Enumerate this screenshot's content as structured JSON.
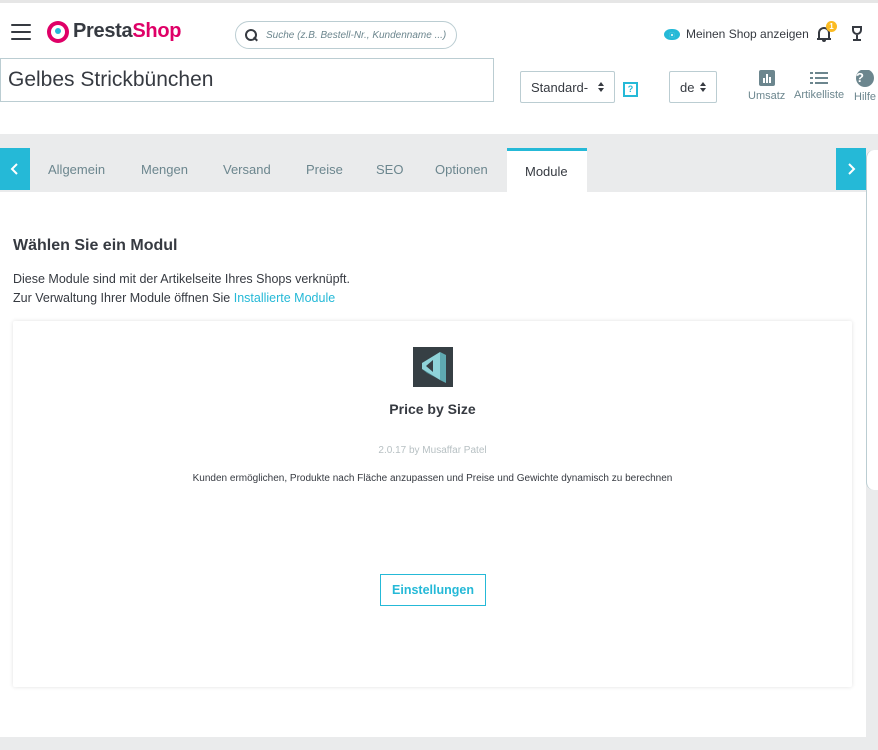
{
  "header": {
    "logo_main": "Presta",
    "logo_accent": "Shop",
    "search_placeholder": "Suche (z.B. Bestell-Nr., Kundenname ...)",
    "view_shop_label": "Meinen Shop anzeigen",
    "notification_count": "1"
  },
  "product": {
    "name": "Gelbes Strickbünchen",
    "type_select": "Standard-",
    "language_select": "de",
    "help_badge": "?"
  },
  "toolbar": {
    "sales_label": "Umsatz",
    "list_label": "Artikelliste",
    "help_label": "Hilfe"
  },
  "tabs": [
    {
      "label": "Allgemein"
    },
    {
      "label": "Mengen"
    },
    {
      "label": "Versand"
    },
    {
      "label": "Preise"
    },
    {
      "label": "SEO"
    },
    {
      "label": "Optionen"
    },
    {
      "label": "Module",
      "active": true
    }
  ],
  "content": {
    "heading": "Wählen Sie ein Modul",
    "desc_line1": "Diese Module sind mit der Artikelseite Ihres Shops verknüpft.",
    "desc_line2_prefix": "Zur Verwaltung Ihrer Module öffnen Sie ",
    "desc_link": "Installierte Module"
  },
  "module": {
    "name": "Price by Size",
    "meta": "2.0.17 by Musaffar Patel",
    "description": "Kunden ermöglichen, Produkte nach Fläche anzupassen und Preise und Gewichte dynamisch zu berechnen",
    "button_label": "Einstellungen"
  },
  "colors": {
    "accent": "#25b9d7",
    "brand": "#df0067",
    "badge": "#fbbb22"
  }
}
